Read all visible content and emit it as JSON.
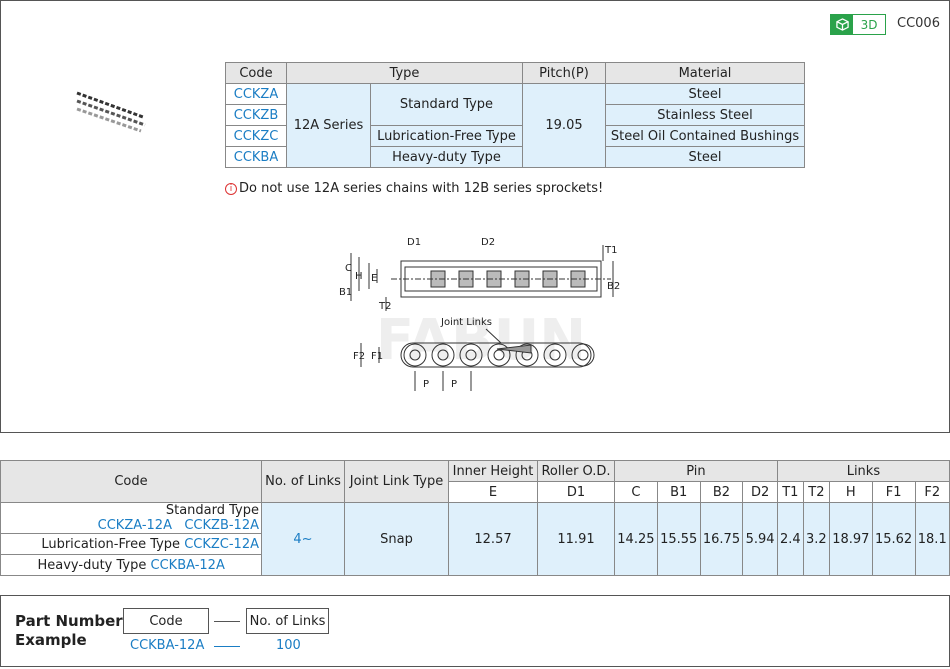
{
  "header": {
    "badge_3d": "3D",
    "series_code": "CC006"
  },
  "type_table": {
    "headers": [
      "Code",
      "Type",
      "Pitch(P)",
      "Material"
    ],
    "codes": [
      "CCKZA",
      "CCKZB",
      "CCKZC",
      "CCKBA"
    ],
    "series": "12A Series",
    "types": [
      "Standard Type",
      "Lubrication-Free Type",
      "Heavy-duty Type"
    ],
    "pitch": "19.05",
    "materials": [
      "Steel",
      "Stainless Steel",
      "Steel Oil Contained Bushings",
      "Steel"
    ]
  },
  "warning": "Do not use 12A series chains with 12B series sprockets!",
  "diagram": {
    "labels": {
      "d1": "D1",
      "d2": "D2",
      "t1": "T1",
      "t2": "T2",
      "h": "H",
      "c": "C",
      "e": "E",
      "b1": "B1",
      "b2": "B2",
      "f1": "F1",
      "f2": "F2",
      "p": "P",
      "joint": "Joint Links"
    }
  },
  "spec_table": {
    "headers": {
      "code": "Code",
      "links": "No. of Links",
      "joint_type": "Joint Link Type",
      "inner_height": "Inner Height",
      "roller_od": "Roller O.D.",
      "pin": "Pin",
      "links_group": "Links"
    },
    "subheaders": [
      "E",
      "D1",
      "C",
      "B1",
      "B2",
      "D2",
      "T1",
      "T2",
      "H",
      "F1",
      "F2"
    ],
    "rows": [
      {
        "type": "Standard Type",
        "codes": "CCKZA-12A   CCKZB-12A"
      },
      {
        "type": "Lubrication-Free Type",
        "codes": "CCKZC-12A"
      },
      {
        "type": "Heavy-duty Type",
        "codes": "CCKBA-12A"
      }
    ],
    "links_value": "4~",
    "joint_value": "Snap",
    "values": [
      "12.57",
      "11.91",
      "14.25",
      "15.55",
      "16.75",
      "5.94",
      "2.4",
      "3.2",
      "18.97",
      "15.62",
      "18.1"
    ]
  },
  "part_example": {
    "title_line1": "Part Number",
    "title_line2": "Example",
    "code_label": "Code",
    "links_label": "No. of Links",
    "code_value": "CCKBA-12A",
    "links_value": "100"
  }
}
